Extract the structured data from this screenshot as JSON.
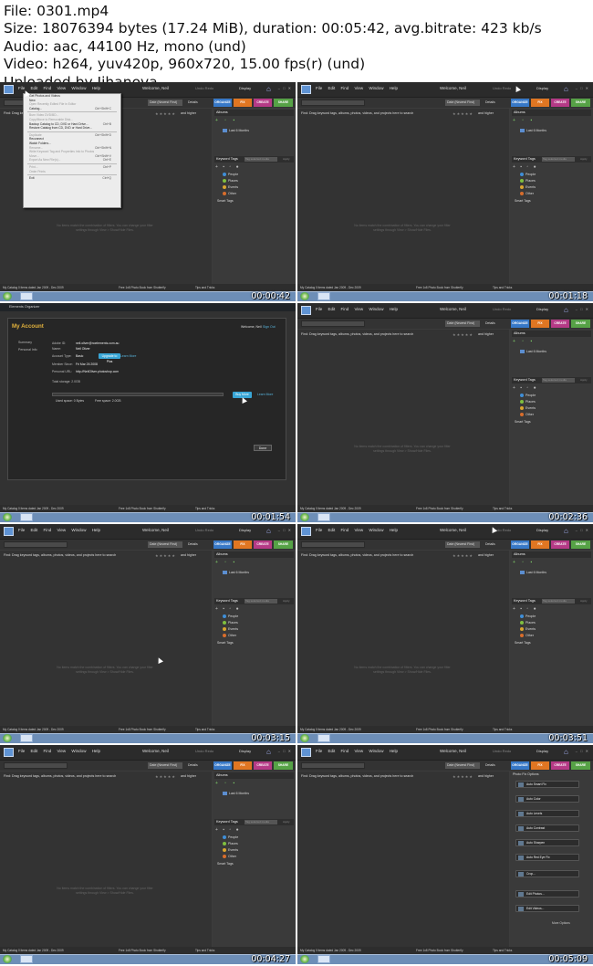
{
  "header": {
    "file": "File: 0301.mp4",
    "size": "Size: 18076394 bytes (17.24 MiB), duration: 00:05:42, avg.bitrate: 423 kb/s",
    "audio": "Audio: aac, 44100 Hz, mono (und)",
    "video": "Video: h264, yuv420p, 960x720, 15.00 fps(r) (und)",
    "uploader": "Uploaded by Jihanova"
  },
  "app": {
    "menus": "File Edit Find View Window Help",
    "welcome": "Welcome, Neil",
    "undo": "Undo Redo",
    "display": "Display",
    "date_view": "Date (Newest First)",
    "details": "Details",
    "tabs": {
      "organize": "ORGANIZE",
      "fix": "FIX",
      "create": "CREATE",
      "share": "SHARE"
    },
    "hint": "Find: Drag keyword tags, albums, photos, videos, and projects here to search",
    "stars": "★★★★★",
    "higher": "and higher",
    "empty_msg": "No items match the combination of filters. You can change your filter settings through View > Show/Hide Files.",
    "albums_header": "Albums",
    "album_item": "Last 6 Months",
    "keyword_header": "Keyword Tags",
    "keyword_find": "Tag selected media",
    "keyword_apply": "Apply",
    "keywords": [
      "People",
      "Places",
      "Events",
      "Other"
    ],
    "smart_tags": "Smart Tags",
    "status": "My Catalog   0 items dated Jan 2009 - Dec 2009",
    "photobook": "Free 1x8 Photo Book from Shutterfly",
    "tips": "Tips and Tricks"
  },
  "colors": {
    "organize": "#3778c7",
    "fix": "#e07622",
    "create": "#b53a86",
    "share": "#56a246",
    "keywords": [
      "#3f8ed8",
      "#7fbf3f",
      "#d9a630",
      "#d86d2c"
    ]
  },
  "file_menu": [
    {
      "label": "Get Photos and Videos",
      "shortcut": "",
      "dim": false
    },
    {
      "label": "New",
      "shortcut": "",
      "dim": false
    },
    {
      "label": "Open Recently Edited File in Editor",
      "shortcut": "",
      "dim": true
    },
    {
      "label": "Catalog...",
      "shortcut": "Ctrl+Shift+C",
      "dim": false
    },
    {
      "sep": true
    },
    {
      "label": "Burn Video DVD/BD...",
      "shortcut": "",
      "dim": true
    },
    {
      "label": "Copy/Move to Removable Disk...",
      "shortcut": "",
      "dim": true
    },
    {
      "label": "Backup Catalog to CD, DVD or Hard Drive...",
      "shortcut": "Ctrl+B",
      "dim": false
    },
    {
      "label": "Restore Catalog from CD, DVD or Hard Drive...",
      "shortcut": "",
      "dim": false
    },
    {
      "sep": true
    },
    {
      "label": "Duplicate",
      "shortcut": "Ctrl+Shift+D",
      "dim": true
    },
    {
      "label": "Reconnect",
      "shortcut": "",
      "dim": false
    },
    {
      "label": "Watch Folders...",
      "shortcut": "",
      "dim": false
    },
    {
      "label": "Rename...",
      "shortcut": "Ctrl+Shift+N",
      "dim": true
    },
    {
      "label": "Write Keyword Tag and Properties Info to Photos",
      "shortcut": "",
      "dim": true
    },
    {
      "label": "Move...",
      "shortcut": "Ctrl+Shift+V",
      "dim": true
    },
    {
      "label": "Export As New File(s)...",
      "shortcut": "Ctrl+E",
      "dim": true
    },
    {
      "sep": true
    },
    {
      "label": "Print...",
      "shortcut": "Ctrl+P",
      "dim": true
    },
    {
      "label": "Order Prints",
      "shortcut": "",
      "dim": true
    },
    {
      "sep": true
    },
    {
      "label": "Exit",
      "shortcut": "Ctrl+Q",
      "dim": false
    }
  ],
  "account": {
    "window_title": "Elements Organizer",
    "title": "My Account",
    "welcome": "Welcome, Neil",
    "sign_out": "Sign Out",
    "nav": [
      "Summary",
      "Personal Info"
    ],
    "fields": [
      {
        "label": "Adobe ID:",
        "value": "neil.oliver@noelements.com.au"
      },
      {
        "label": "Name:",
        "value": "Neil Oliver"
      },
      {
        "label": "Account Type:",
        "value": "Basic"
      },
      {
        "label": "Member Since:",
        "value": "Fri Mar 26 2008"
      },
      {
        "label": "Personal URL:",
        "value": "http://NeilOliver.photoshop.com"
      }
    ],
    "upgrade": "Upgrade to Plus",
    "learn_more": "Learn More",
    "total_storage": "Total storage: 2.0GB",
    "buy_more": "Buy More",
    "used": "Used space: 0 Bytes",
    "free": "Free space: 2.0GB",
    "done": "Done"
  },
  "fix_options": {
    "header": "Photo Fix Options",
    "buttons": [
      "Auto Smart Fix",
      "Auto Color",
      "Auto Levels",
      "Auto Contrast",
      "Auto Sharpen",
      "Auto Red Eye Fix",
      "Crop...",
      "Edit Photos...",
      "Edit Videos..."
    ],
    "more": "More Options"
  },
  "timestamps": [
    "00:00:42",
    "00:01:18",
    "00:01:54",
    "00:02:36",
    "00:03:15",
    "00:03:51",
    "00:04:27",
    "00:05:09"
  ]
}
